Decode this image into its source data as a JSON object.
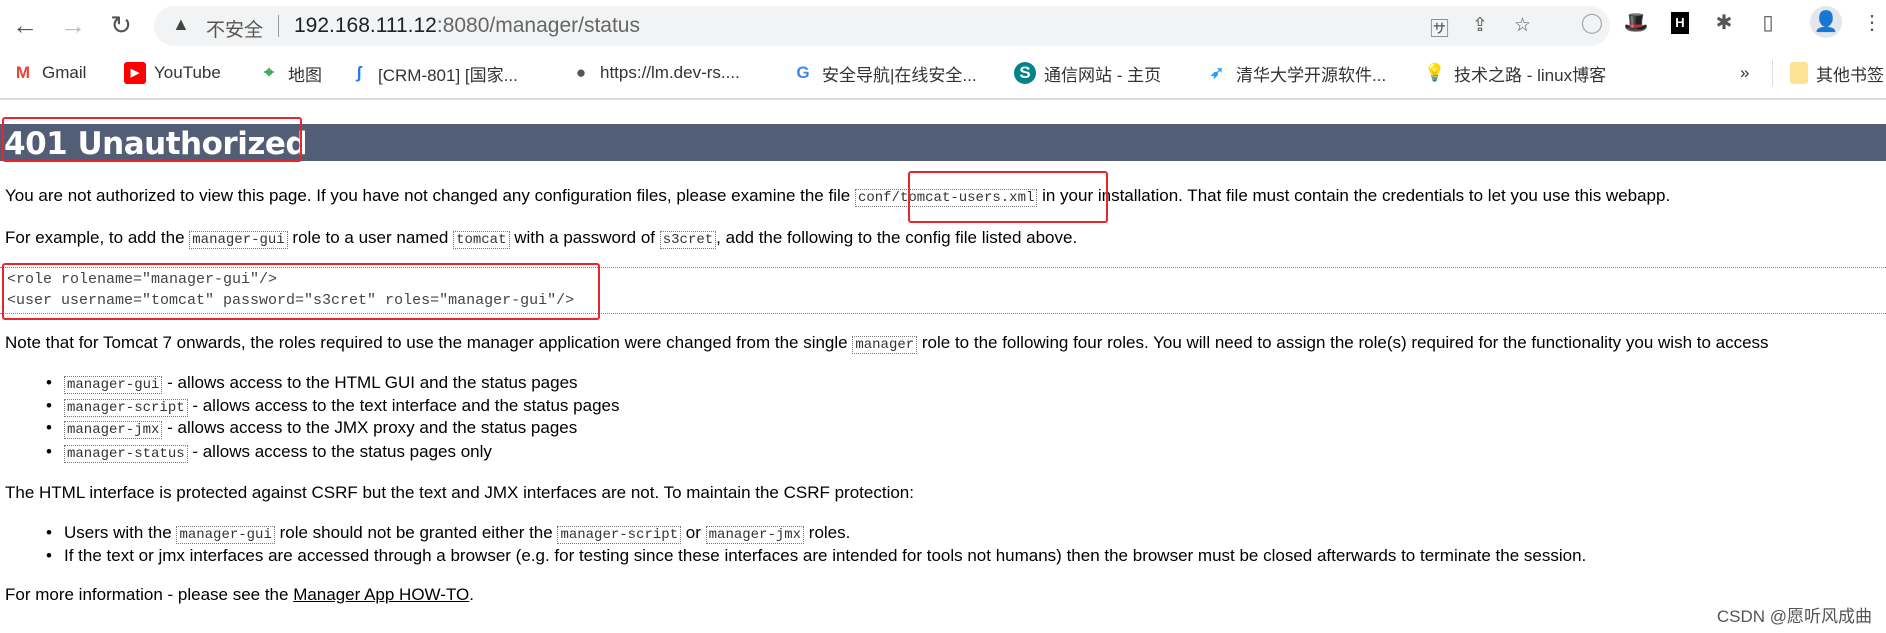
{
  "browser": {
    "back_icon": "arrow-left",
    "forward_icon": "arrow-right",
    "reload_icon": "reload",
    "security_label": "不安全",
    "url_host": "192.168.111.12",
    "url_rest": ":8080/manager/status",
    "bookmarks": [
      {
        "label": "Gmail",
        "icon": "gmail",
        "color": "#ea4335"
      },
      {
        "label": "YouTube",
        "icon": "youtube",
        "color": "#ff0000"
      },
      {
        "label": "地图",
        "icon": "maps",
        "color": "#34a853"
      },
      {
        "label": "[CRM-801] [国家...",
        "icon": "jira",
        "color": "#1f7bf2"
      },
      {
        "label": "https://lm.dev-rs....",
        "icon": "globe",
        "color": "#555555"
      },
      {
        "label": "安全导航|在线安全...",
        "icon": "google",
        "color": "#4285f4"
      },
      {
        "label": "通信网站 - 主页",
        "icon": "sharepoint",
        "color": "#038387"
      },
      {
        "label": "清华大学开源软件...",
        "icon": "tuna",
        "color": "#2ba4f0"
      },
      {
        "label": "技术之路 - linux博客",
        "icon": "bulb",
        "color": "#f5c400"
      }
    ],
    "more_bookmarks": "»",
    "other_bookmarks": "其他书签"
  },
  "page": {
    "title": "401 Unauthorized",
    "p1_a": "You are not authorized to view this page. If you have not changed any configuration files, please examine the file ",
    "p1_code": "conf/tomcat-users.xml",
    "p1_b": " in your installation. That file must contain the credentials to let you use this webapp.",
    "p2_a": "For example, to add the ",
    "p2_code1": "manager-gui",
    "p2_b": " role to a user named ",
    "p2_code2": "tomcat",
    "p2_c": " with a password of ",
    "p2_code3": "s3cret",
    "p2_d": ", add the following to the config file listed above.",
    "pre_line1": "<role rolename=\"manager-gui\"/>",
    "pre_line2": "<user username=\"tomcat\" password=\"s3cret\" roles=\"manager-gui\"/>",
    "p3_a": "Note that for Tomcat 7 onwards, the roles required to use the manager application were changed from the single ",
    "p3_code": "manager",
    "p3_b": " role to the following four roles. You will need to assign the role(s) required for the functionality you wish to access",
    "roles": [
      {
        "code": "manager-gui",
        "text": " - allows access to the HTML GUI and the status pages"
      },
      {
        "code": "manager-script",
        "text": " - allows access to the text interface and the status pages"
      },
      {
        "code": "manager-jmx",
        "text": " - allows access to the JMX proxy and the status pages"
      },
      {
        "code": "manager-status",
        "text": " - allows access to the status pages only"
      }
    ],
    "p4": "The HTML interface is protected against CSRF but the text and JMX interfaces are not. To maintain the CSRF protection:",
    "b1_a": "Users with the ",
    "b1_code1": "manager-gui",
    "b1_b": " role should not be granted either the ",
    "b1_code2": "manager-script",
    "b1_c": " or ",
    "b1_code3": "manager-jmx",
    "b1_d": " roles.",
    "b2": "If the text or jmx interfaces are accessed through a browser (e.g. for testing since these interfaces are intended for tools not humans) then the browser must be closed afterwards to terminate the session.",
    "p5_a": "For more information - please see the ",
    "p5_link": "Manager App HOW-TO",
    "p5_b": ".",
    "watermark": "CSDN @愿听风成曲"
  },
  "colors": {
    "header_bg": "#525d76",
    "annotation_red": "#e8262b"
  }
}
